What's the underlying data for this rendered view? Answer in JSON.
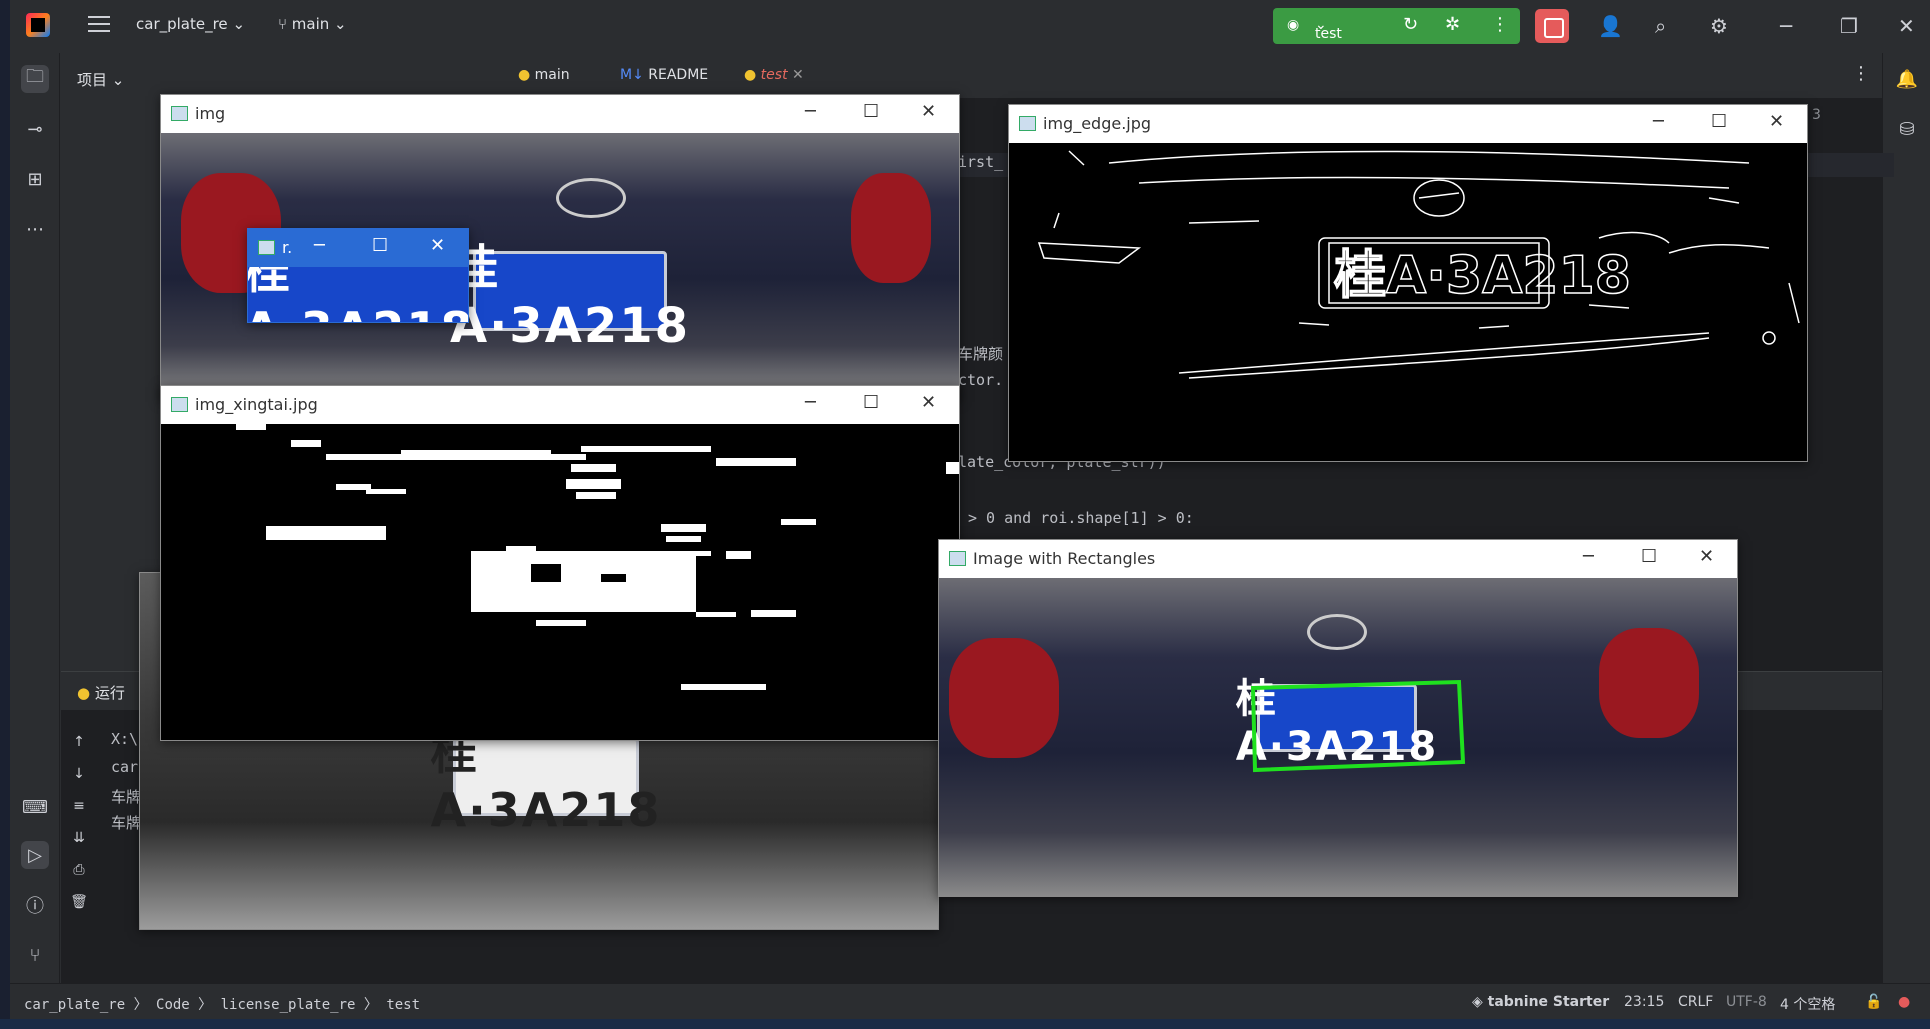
{
  "titlebar": {
    "project": "car_plate_re",
    "branch": "main",
    "run_config": "test"
  },
  "project_panel": {
    "title": "项目"
  },
  "editor": {
    "tabs": [
      {
        "label": "main"
      },
      {
        "label": "README"
      },
      {
        "label": "test"
      }
    ],
    "code_lines": [
      "irst_",
      "车牌颜",
      "ctor.",
      "late_color, plate_str))",
      "> 0 and roi.shape[1] > 0:"
    ],
    "counter": "3"
  },
  "run_panel": {
    "title": "运行",
    "lines": [
      "X:\\",
      "car",
      "车牌",
      "车牌"
    ]
  },
  "statusbar": {
    "breadcrumb": [
      "car_plate_re",
      "Code",
      "license_plate_re",
      "test"
    ],
    "tabnine": "tabnine Starter",
    "position": "23:15",
    "line_ending": "CRLF",
    "encoding": "UTF-8",
    "indent": "4 个空格"
  },
  "windows": {
    "img": {
      "title": "img"
    },
    "roi": {
      "title": "r."
    },
    "xingtai": {
      "title": "img_xingtai.jpg"
    },
    "edge": {
      "title": "img_edge.jpg"
    },
    "rect": {
      "title": "Image with Rectangles"
    }
  },
  "plate_text": "桂A·3A218",
  "colors": {
    "run_green": "#3b9b43",
    "stop_red": "#e55b5b",
    "plate_blue": "#1747c9",
    "rect_green": "#1fe01f"
  }
}
